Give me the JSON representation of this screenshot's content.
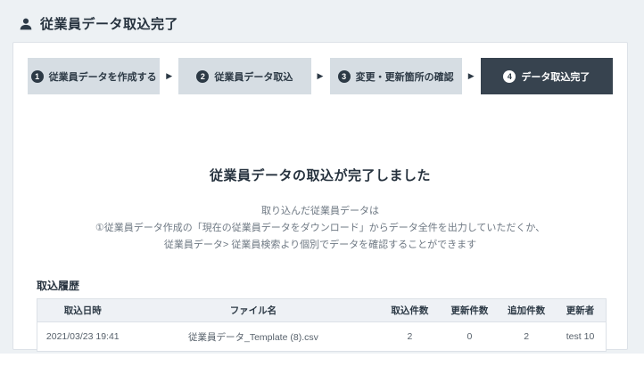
{
  "page": {
    "title": "従業員データ取込完了"
  },
  "stepper": {
    "separator": "▶",
    "steps": [
      {
        "number": "1",
        "label": "従業員データを作成する",
        "active": false
      },
      {
        "number": "2",
        "label": "従業員データ取込",
        "active": false
      },
      {
        "number": "3",
        "label": "変更・更新箇所の確認",
        "active": false
      },
      {
        "number": "4",
        "label": "データ取込完了",
        "active": true
      }
    ]
  },
  "result": {
    "heading": "従業員データの取込が完了しました",
    "description_lines": [
      "取り込んだ従業員データは",
      "①従業員データ作成の「現在の従業員データをダウンロード」からデータ全件を出力していただくか、",
      "従業員データ> 従業員検索より個別でデータを確認することができます"
    ]
  },
  "history": {
    "title": "取込履歴",
    "columns": [
      "取込日時",
      "ファイル名",
      "取込件数",
      "更新件数",
      "追加件数",
      "更新者"
    ],
    "rows": [
      [
        "2021/03/23 19:41",
        "従業員データ_Template (8).csv",
        "2",
        "0",
        "2",
        "test 10"
      ]
    ]
  },
  "colors": {
    "page_background": "#edf1f4",
    "card_background": "#ffffff",
    "step_inactive_background": "#d6dde3",
    "step_active_background": "#37434f",
    "dark_text": "#26323e",
    "muted_text": "#6e7883",
    "table_header_background": "#eef1f5",
    "border": "#dde2e8"
  }
}
